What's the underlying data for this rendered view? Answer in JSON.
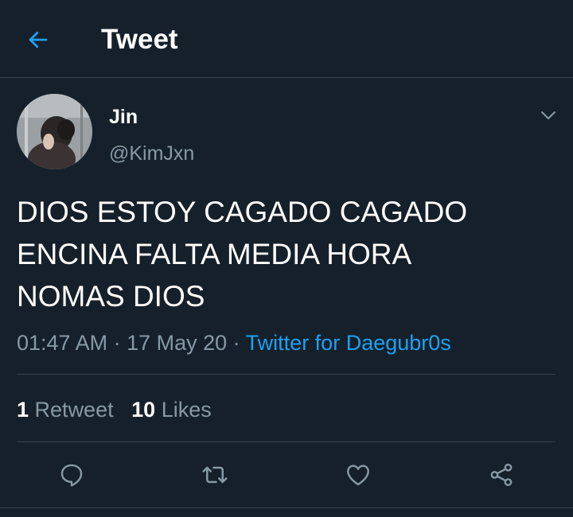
{
  "header": {
    "title": "Tweet"
  },
  "tweet": {
    "author_name": "Jin",
    "author_handle": "@KimJxn",
    "lines": [
      "DIOS ESTOY CAGADO CAGADO",
      "ENCINA FALTA MEDIA HORA",
      "NOMAS DIOS"
    ],
    "time": "01:47 AM",
    "date": "17 May 20",
    "source": "Twitter for Daegubr0s",
    "separator": " · "
  },
  "stats": {
    "retweets_count": "1",
    "retweets_label": "Retweet",
    "likes_count": "10",
    "likes_label": "Likes"
  },
  "icons": {
    "back": "arrow-left-icon",
    "menu": "chevron-down-icon",
    "reply": "reply-icon",
    "retweet": "retweet-icon",
    "like": "heart-icon",
    "share": "share-icon"
  },
  "colors": {
    "background": "#15202b",
    "accent": "#1da1f2",
    "secondary_text": "#8899a6",
    "divider": "#38444d"
  }
}
